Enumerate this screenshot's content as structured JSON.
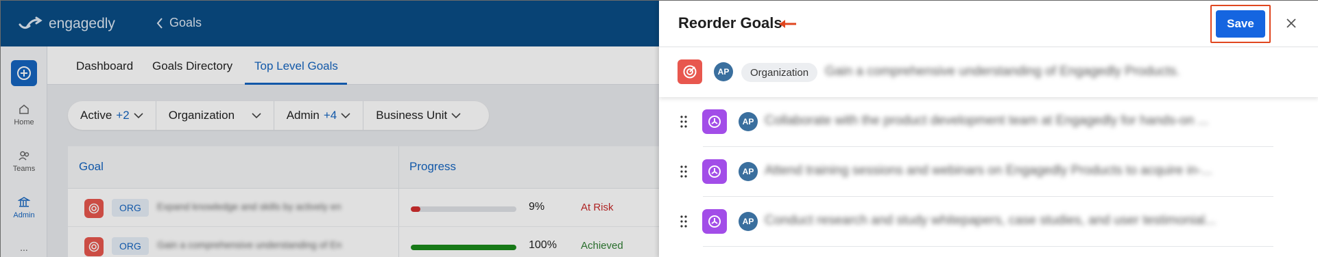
{
  "app": {
    "logo_text": "engagedly",
    "back_label": "Goals",
    "brand_color": "#0a4d86"
  },
  "sidebar": {
    "items": [
      {
        "label": "Home",
        "icon": "home-icon"
      },
      {
        "label": "Teams",
        "icon": "teams-icon"
      },
      {
        "label": "Admin",
        "icon": "admin-icon"
      }
    ],
    "more": "..."
  },
  "tabs": [
    {
      "label": "Dashboard"
    },
    {
      "label": "Goals Directory"
    },
    {
      "label": "Top Level Goals",
      "active": true
    }
  ],
  "filters": [
    {
      "label": "Active",
      "count": "+2"
    },
    {
      "label": "Organization",
      "count": ""
    },
    {
      "label": "Admin",
      "count": "+4"
    },
    {
      "label": "Business Unit",
      "count": ""
    }
  ],
  "table": {
    "columns": [
      "Goal",
      "Progress"
    ],
    "rows": [
      {
        "badge": "ORG",
        "text": "Expand knowledge and skills by actively en",
        "progress": 0.09,
        "percent": "9%",
        "status": "At Risk",
        "status_color": "#c62828",
        "bar_color": "#d32f2f"
      },
      {
        "badge": "ORG",
        "text": "Gain a comprehensive understanding of En",
        "progress": 1.0,
        "percent": "100%",
        "status": "Achieved",
        "status_color": "#2e7d32",
        "bar_color": "#1b8a1b"
      }
    ]
  },
  "drawer": {
    "title": "Reorder Goals",
    "save_label": "Save",
    "parent_goal": {
      "avatar": "AP",
      "chip": "Organization",
      "text": "Gain a comprehensive understanding of Engagedly Products."
    },
    "child_goals": [
      {
        "avatar": "AP",
        "text": "Collaborate with the product development team at Engagedly for hands-on ..."
      },
      {
        "avatar": "AP",
        "text": "Attend training sessions and webinars on Engagedly Products to acquire in-..."
      },
      {
        "avatar": "AP",
        "text": "Conduct research and study whitepapers, case studies, and user testimonial..."
      }
    ],
    "accent_color": "#1565e0",
    "highlight_color": "#e0461f"
  }
}
